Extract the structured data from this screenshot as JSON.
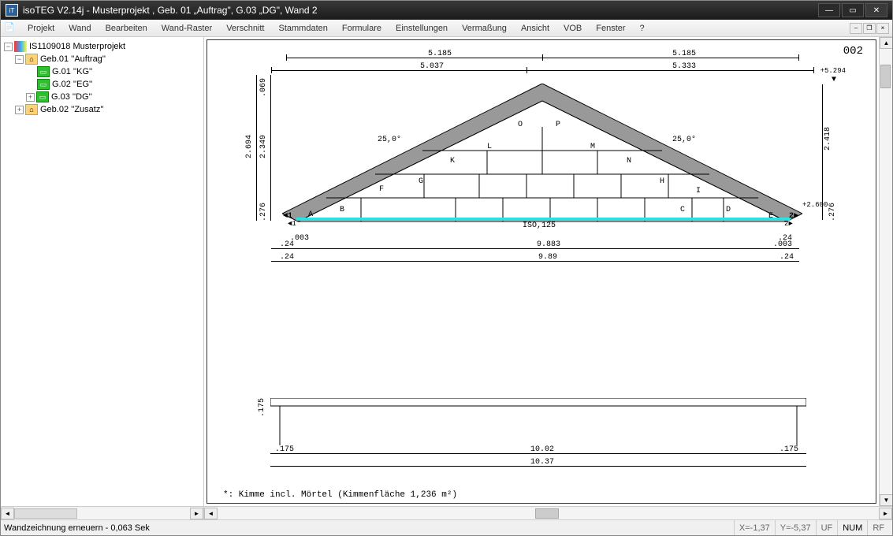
{
  "title": "isoTEG V2.14j -   Musterprojekt , Geb. 01 „Auftrag\", G.03 „DG\", Wand 2",
  "menu": [
    "Projekt",
    "Wand",
    "Bearbeiten",
    "Wand-Raster",
    "Verschnitt",
    "Stammdaten",
    "Formulare",
    "Einstellungen",
    "Vermaßung",
    "Ansicht",
    "VOB",
    "Fenster",
    "?"
  ],
  "tree": {
    "root": "IS1109018 Musterprojekt",
    "geb01": "Geb.01 ''Auftrag''",
    "g01": "G.01 ''KG''",
    "g02": "G.02 ''EG''",
    "g03": "G.03 ''DG''",
    "geb02": "Geb.02 ''Zusatz''"
  },
  "drawing": {
    "page_num": "002",
    "top_dims": {
      "left": "5.185",
      "right": "5.185"
    },
    "second_dims": {
      "left": "5.037",
      "right": "5.333"
    },
    "right_annot": "+5.294",
    "right_dim_v": "2.418",
    "left_dims_v": {
      "top": ".069",
      "mid": "2.694",
      "mid2": "2.349",
      "bot": ".276"
    },
    "right_bot_v": ".276",
    "right_bot_annot": "+2.600",
    "angle_left": "25,0°",
    "angle_right": "25,0°",
    "blocks": [
      "A",
      "B",
      "C",
      "D",
      "E",
      "F",
      "G",
      "H",
      "I",
      "K",
      "L",
      "M",
      "N",
      "O",
      "P"
    ],
    "iso_label": "ISO,125",
    "bot_dims1": {
      "l": ".003",
      "m": "9.883",
      "r": ".24"
    },
    "bot_dims0": {
      "l": ".24",
      "r": ".003"
    },
    "bot_dims2": {
      "l": ".24",
      "m": "9.89",
      "r": ".24"
    },
    "lower_rect_v": ".175",
    "lower_dims1": {
      "l": ".175",
      "m": "10.02",
      "r": ".175"
    },
    "lower_dims2": "10.37",
    "footnote": "*: Kimme incl. Mörtel  (Kimmenfläche 1,236 m²)"
  },
  "status": {
    "left": "Wandzeichnung erneuern - 0,063 Sek",
    "coords_x": "X=-1,37",
    "coords_y": "Y=-5,37",
    "uf": "UF",
    "num": "NUM",
    "rf": "RF"
  }
}
